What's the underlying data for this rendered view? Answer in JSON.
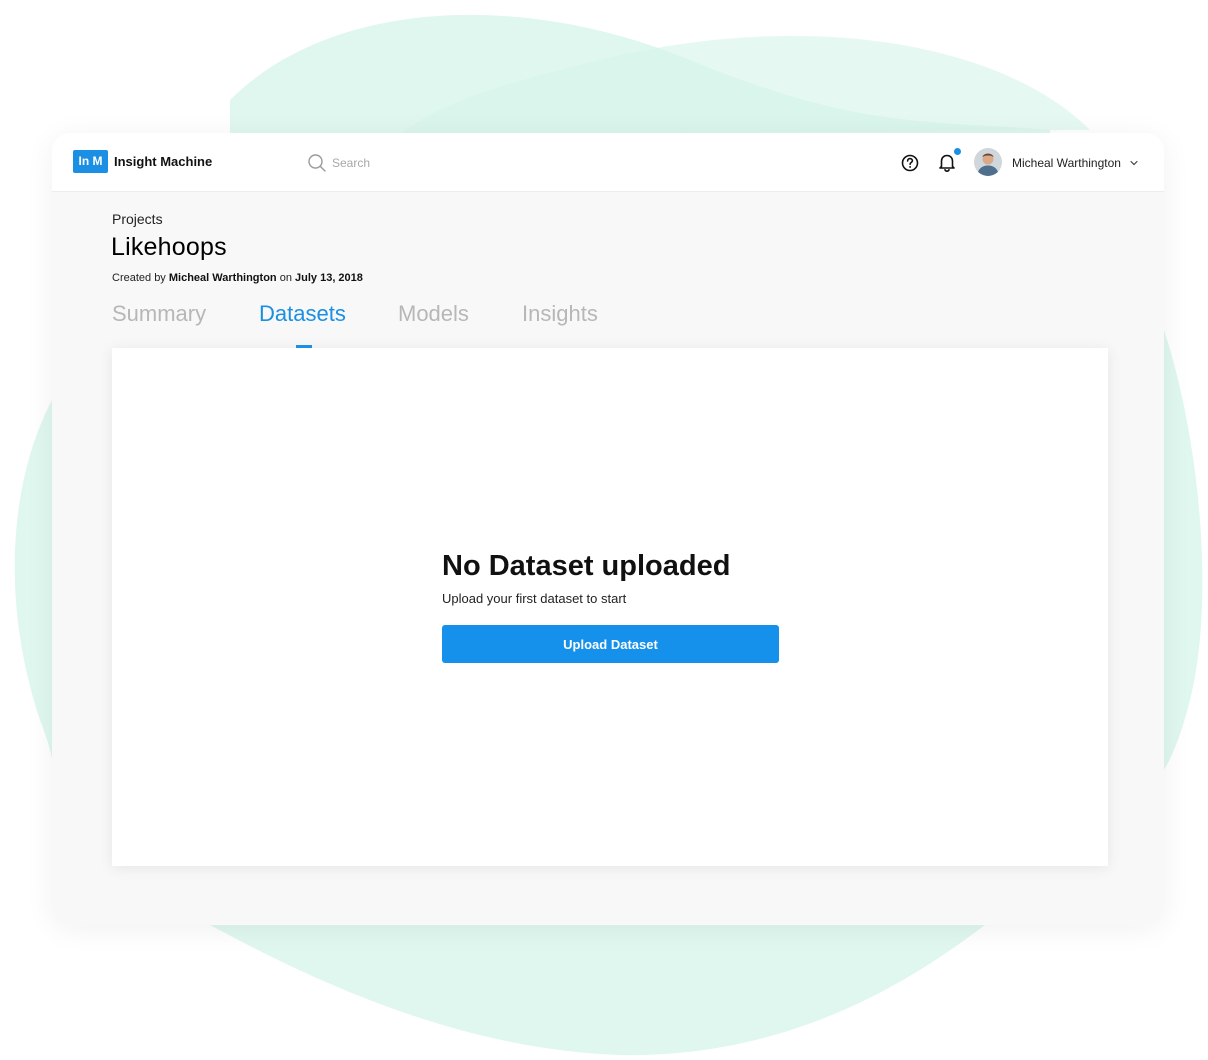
{
  "colors": {
    "accent": "#1a8fe3",
    "blob": "#dff7ef",
    "tab_inactive": "#b7b7b7",
    "window_bg": "#f8f8f8"
  },
  "header": {
    "logo": {
      "text": "In M"
    },
    "app_name": "Insight Machine",
    "search": {
      "placeholder": "Search",
      "value": "",
      "icon": "search-icon"
    },
    "icons": {
      "help": "help-circle-icon",
      "notifications": "bell-icon"
    },
    "notification_unread": true,
    "user": {
      "name": "Micheal Warthington",
      "avatar_icon": "user-avatar",
      "menu_icon": "chevron-down-icon"
    }
  },
  "page": {
    "breadcrumb": "Projects",
    "title": "Likehoops",
    "meta": {
      "prefix": "Created by",
      "author": "Micheal Warthington",
      "joiner": "on",
      "date": "July 13, 2018"
    }
  },
  "tabs": [
    {
      "label": "Summary",
      "active": false
    },
    {
      "label": "Datasets",
      "active": true
    },
    {
      "label": "Models",
      "active": false
    },
    {
      "label": "Insights",
      "active": false
    }
  ],
  "empty_state": {
    "title": "No Dataset uploaded",
    "subtitle": "Upload your first dataset to start",
    "button_label": "Upload Dataset"
  }
}
